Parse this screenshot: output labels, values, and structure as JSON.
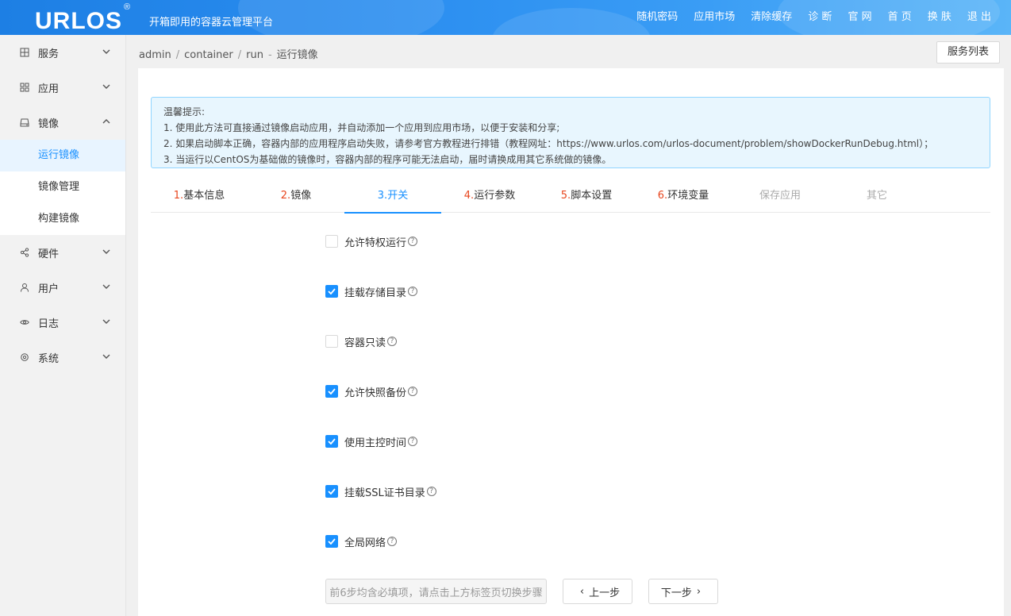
{
  "header": {
    "logo": "URLOS",
    "logo_mark": "®",
    "slogan": "开箱即用的容器云管理平台",
    "nav": [
      "随机密码",
      "应用市场",
      "清除缓存",
      "诊 断",
      "官 网",
      "首 页",
      "换 肤",
      "退 出"
    ]
  },
  "sidebar": {
    "items": [
      {
        "label": "服务",
        "icon": "grid-icon",
        "expanded": false
      },
      {
        "label": "应用",
        "icon": "apps-icon",
        "expanded": false
      },
      {
        "label": "镜像",
        "icon": "disk-icon",
        "expanded": true,
        "children": [
          "运行镜像",
          "镜像管理",
          "构建镜像"
        ],
        "active_child": "运行镜像"
      },
      {
        "label": "硬件",
        "icon": "share-icon",
        "expanded": false
      },
      {
        "label": "用户",
        "icon": "user-icon",
        "expanded": false
      },
      {
        "label": "日志",
        "icon": "eye-icon",
        "expanded": false
      },
      {
        "label": "系统",
        "icon": "gear-icon",
        "expanded": false
      }
    ]
  },
  "breadcrumb": {
    "items": [
      "admin",
      "container",
      "run"
    ],
    "current": "运行镜像"
  },
  "service_list_button": "服务列表",
  "tip": {
    "title": "温馨提示:",
    "lines": [
      "1. 使用此方法可直接通过镜像启动应用，并自动添加一个应用到应用市场，以便于安装和分享;",
      "2. 如果启动脚本正确，容器内部的应用程序启动失败，请参考官方教程进行排错（教程网址：https://www.urlos.com/urlos-document/problem/showDockerRunDebug.html）；",
      "3. 当运行以CentOS为基础做的镜像时，容器内部的程序可能无法启动，届时请换成用其它系统做的镜像。"
    ]
  },
  "tabs": [
    {
      "num": "1.",
      "label": "基本信息",
      "state": "normal"
    },
    {
      "num": "2.",
      "label": "镜像",
      "state": "normal"
    },
    {
      "num": "3.",
      "label": "开关",
      "state": "active"
    },
    {
      "num": "4.",
      "label": "运行参数",
      "state": "normal"
    },
    {
      "num": "5.",
      "label": "脚本设置",
      "state": "normal"
    },
    {
      "num": "6.",
      "label": "环境变量",
      "state": "normal"
    },
    {
      "num": "",
      "label": "保存应用",
      "state": "disabled"
    },
    {
      "num": "",
      "label": "其它",
      "state": "disabled"
    }
  ],
  "options": [
    {
      "label": "允许特权运行",
      "checked": false
    },
    {
      "label": "挂载存储目录",
      "checked": true
    },
    {
      "label": "容器只读",
      "checked": false
    },
    {
      "label": "允许快照备份",
      "checked": true
    },
    {
      "label": "使用主控时间",
      "checked": true
    },
    {
      "label": "挂载SSL证书目录",
      "checked": true
    },
    {
      "label": "全局网络",
      "checked": true
    }
  ],
  "footer": {
    "hint": "前6步均含必填项，请点击上方标签页切换步骤",
    "prev": "上一步",
    "next": "下一步"
  },
  "colors": {
    "accent": "#1890ff",
    "tab_number": "#e8471f",
    "tip_bg": "#e8f6fe",
    "tip_border": "#91d5ff"
  }
}
